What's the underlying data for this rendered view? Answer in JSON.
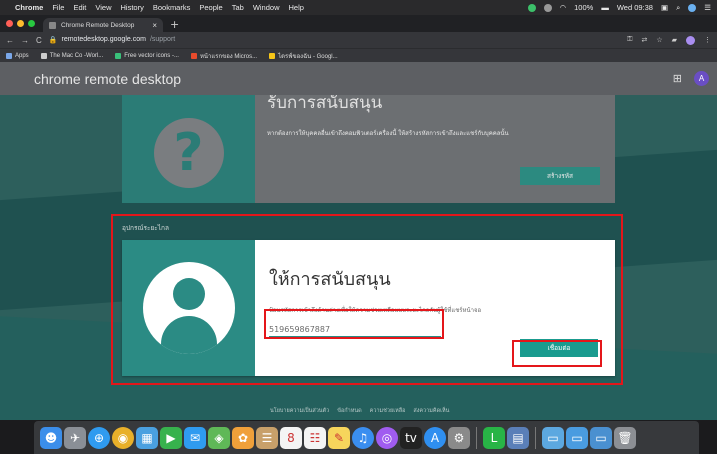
{
  "menubar": {
    "app": "Chrome",
    "items": [
      "File",
      "Edit",
      "View",
      "History",
      "Bookmarks",
      "People",
      "Tab",
      "Window",
      "Help"
    ],
    "battery": "100%",
    "clock": "Wed 09:38"
  },
  "tab": {
    "title": "Chrome Remote Desktop",
    "close": "×",
    "new": "+"
  },
  "address": {
    "host": "remotedesktop.google.com",
    "path": "/support"
  },
  "bookmarks": [
    {
      "label": "Apps",
      "color": "#7aa7e8"
    },
    {
      "label": "The Mac Co -Worl...",
      "color": "#cccccc"
    },
    {
      "label": "Free vector icons -...",
      "color": "#39c07a"
    },
    {
      "label": "หน้าแรกของ Micros...",
      "color": "#e84b2c"
    },
    {
      "label": "ไดรฟ์ของฉัน - Googl...",
      "color": "#f5c518"
    }
  ],
  "app": {
    "title": "chrome remote desktop",
    "avatar_letter": "A"
  },
  "access_card": {
    "title": "รับการสนับสนุน",
    "desc": "หากต้องการให้บุคคลอื่นเข้าถึงคอมพิวเตอร์เครื่องนี้ ให้สร้างรหัสการเข้าถึงและแชร์กับบุคคลนั้น",
    "button": "สร้างรหัส"
  },
  "section_label": "อุปกรณ์ระยะไกล",
  "share_card": {
    "title": "ให้การสนับสนุน",
    "desc": "ป้อนรหัสการเข้าถึงด้านล่างเพื่อให้ความช่วยเหลือแบบระยะไกลกับผู้ใช้ที่แชร์หน้าจอ",
    "code_value": "519659867887",
    "button": "เชื่อมต่อ"
  },
  "footer": [
    "นโยบายความเป็นส่วนตัว",
    "ข้อกำหนด",
    "ความช่วยเหลือ",
    "ส่งความคิดเห็น"
  ],
  "dock_icons": [
    {
      "name": "finder-icon",
      "color": "#3b8eea",
      "glyph": "☻"
    },
    {
      "name": "launchpad-icon",
      "color": "#8a8f96",
      "glyph": "✈"
    },
    {
      "name": "safari-icon",
      "color": "#2f9bf0",
      "glyph": "⊕"
    },
    {
      "name": "chrome-icon",
      "color": "#e8b02a",
      "glyph": "◉"
    },
    {
      "name": "preview-icon",
      "color": "#4aa0e0",
      "glyph": "▦"
    },
    {
      "name": "facetime-icon",
      "color": "#37b24d",
      "glyph": "▶"
    },
    {
      "name": "messages-icon",
      "color": "#2f9bf0",
      "glyph": "✉"
    },
    {
      "name": "maps-icon",
      "color": "#5fb857",
      "glyph": "◈"
    },
    {
      "name": "photos-icon",
      "color": "#f0a03a",
      "glyph": "✿"
    },
    {
      "name": "contacts-icon",
      "color": "#c8a06a",
      "glyph": "☰"
    },
    {
      "name": "calendar-icon",
      "color": "#f4f4f4",
      "glyph": "8"
    },
    {
      "name": "reminders-icon",
      "color": "#f4f4f4",
      "glyph": "☷"
    },
    {
      "name": "notes-icon",
      "color": "#f6d55c",
      "glyph": "✎"
    },
    {
      "name": "music-icon",
      "color": "#3a8ef0",
      "glyph": "♫"
    },
    {
      "name": "podcasts-icon",
      "color": "#a05cf0",
      "glyph": "◎"
    },
    {
      "name": "tv-icon",
      "color": "#222222",
      "glyph": "tv"
    },
    {
      "name": "app-store-icon",
      "color": "#2f8ff0",
      "glyph": "A"
    },
    {
      "name": "system-prefs-icon",
      "color": "#8a8a8a",
      "glyph": "⚙"
    },
    {
      "name": "line-icon",
      "color": "#28b446",
      "glyph": "L"
    },
    {
      "name": "screenshot-icon",
      "color": "#5a7fb8",
      "glyph": "▤"
    },
    {
      "name": "folder-icon",
      "color": "#5ca8e0",
      "glyph": "▭"
    },
    {
      "name": "downloads-folder-icon",
      "color": "#4a9ce0",
      "glyph": "▭"
    },
    {
      "name": "desktop-folder-icon",
      "color": "#4a90d0",
      "glyph": "▭"
    },
    {
      "name": "trash-icon",
      "color": "#8c8f94",
      "glyph": "🗑"
    }
  ],
  "colors": {
    "teal": "#2b8b84",
    "annotation_red": "#e4161a"
  }
}
